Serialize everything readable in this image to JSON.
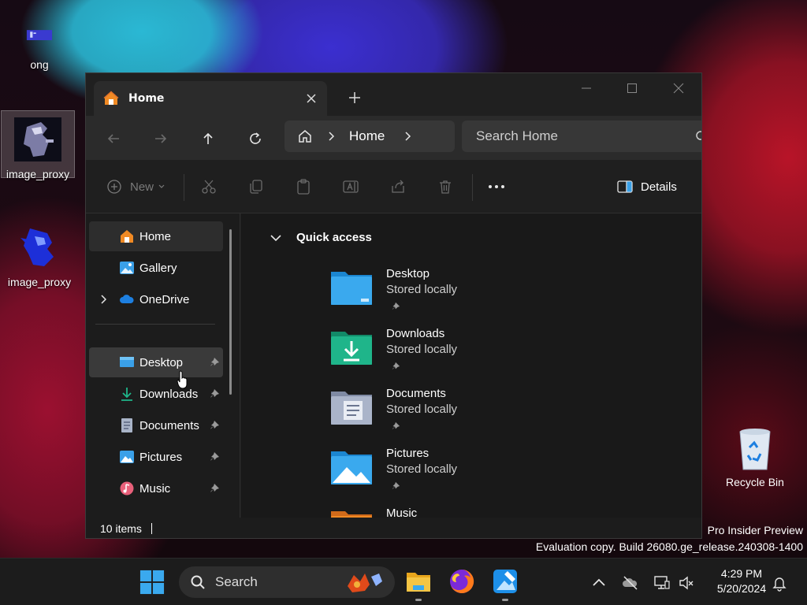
{
  "desktop": {
    "icons": [
      {
        "label": "ong"
      },
      {
        "label": "image_proxy"
      },
      {
        "label": "image_proxy"
      }
    ],
    "recycle_bin": "Recycle Bin",
    "watermark": {
      "line1": "Pro Insider Preview",
      "line2": "Evaluation copy. Build 26080.ge_release.240308-1400"
    }
  },
  "explorer": {
    "tab": {
      "title": "Home"
    },
    "address": {
      "location": "Home"
    },
    "search": {
      "placeholder": "Search Home"
    },
    "toolbar": {
      "new_label": "New",
      "details_label": "Details"
    },
    "sidebar": {
      "items": [
        {
          "label": "Home"
        },
        {
          "label": "Gallery"
        },
        {
          "label": "OneDrive"
        },
        {
          "label": "Desktop"
        },
        {
          "label": "Downloads"
        },
        {
          "label": "Documents"
        },
        {
          "label": "Pictures"
        },
        {
          "label": "Music"
        }
      ]
    },
    "quick_access": {
      "heading": "Quick access",
      "folders": [
        {
          "name": "Desktop",
          "status": "Stored locally"
        },
        {
          "name": "Downloads",
          "status": "Stored locally"
        },
        {
          "name": "Documents",
          "status": "Stored locally"
        },
        {
          "name": "Pictures",
          "status": "Stored locally"
        },
        {
          "name": "Music",
          "status": ""
        }
      ]
    },
    "status_bar": {
      "items_count": "10 items"
    }
  },
  "taskbar": {
    "search_label": "Search",
    "clock": {
      "time": "4:29 PM",
      "date": "5/20/2024"
    }
  },
  "colors": {
    "accent_blue": "#3aa0e8",
    "folder_green": "#1fb58a",
    "window_bg": "#202020"
  }
}
